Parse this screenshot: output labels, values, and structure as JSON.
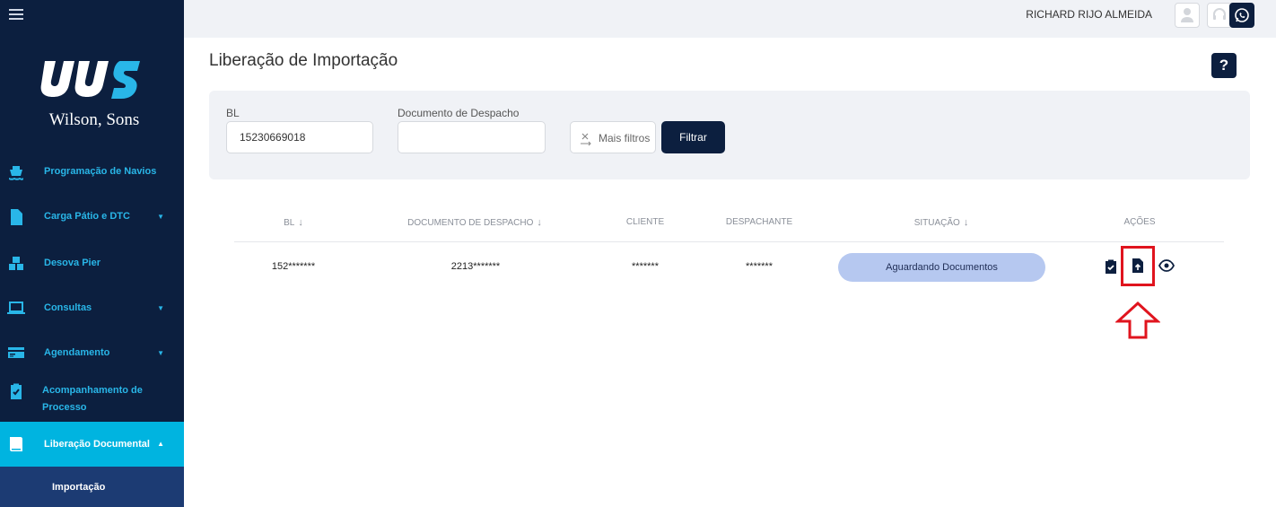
{
  "sidebar": {
    "brand": "Wilson, Sons",
    "items": [
      {
        "label": "Programação de Navios"
      },
      {
        "label": "Carga Pátio e DTC"
      },
      {
        "label": "Desova Pier"
      },
      {
        "label": "Consultas"
      },
      {
        "label": "Agendamento"
      },
      {
        "label": "Acompanhamento de Processo"
      },
      {
        "label": "Liberação Documental"
      }
    ],
    "subitem": "Importação"
  },
  "header": {
    "username": "RICHARD RIJO ALMEIDA"
  },
  "page": {
    "title": "Liberação de Importação",
    "help": "?"
  },
  "filters": {
    "bl_label": "BL",
    "bl_value": "15230669018",
    "despacho_label": "Documento de Despacho",
    "despacho_value": "",
    "more_filters": "Mais filtros",
    "filter_button": "Filtrar"
  },
  "table": {
    "headers": {
      "bl": "BL",
      "documento": "DOCUMENTO DE DESPACHO",
      "cliente": "CLIENTE",
      "despachante": "DESPACHANTE",
      "situacao": "SITUAÇÃO",
      "acoes": "AÇÕES"
    },
    "sort_arrow": "↓",
    "rows": [
      {
        "bl": "152*******",
        "documento": "2213*******",
        "cliente": "*******",
        "despachante": "*******",
        "situacao": "Aguardando Documentos"
      }
    ]
  },
  "colors": {
    "sidebar_bg": "#0c1f3f",
    "accent": "#29b6e8",
    "active_bg": "#00b4e0",
    "status_pill": "#b6c8f0",
    "highlight": "#e0141e"
  }
}
